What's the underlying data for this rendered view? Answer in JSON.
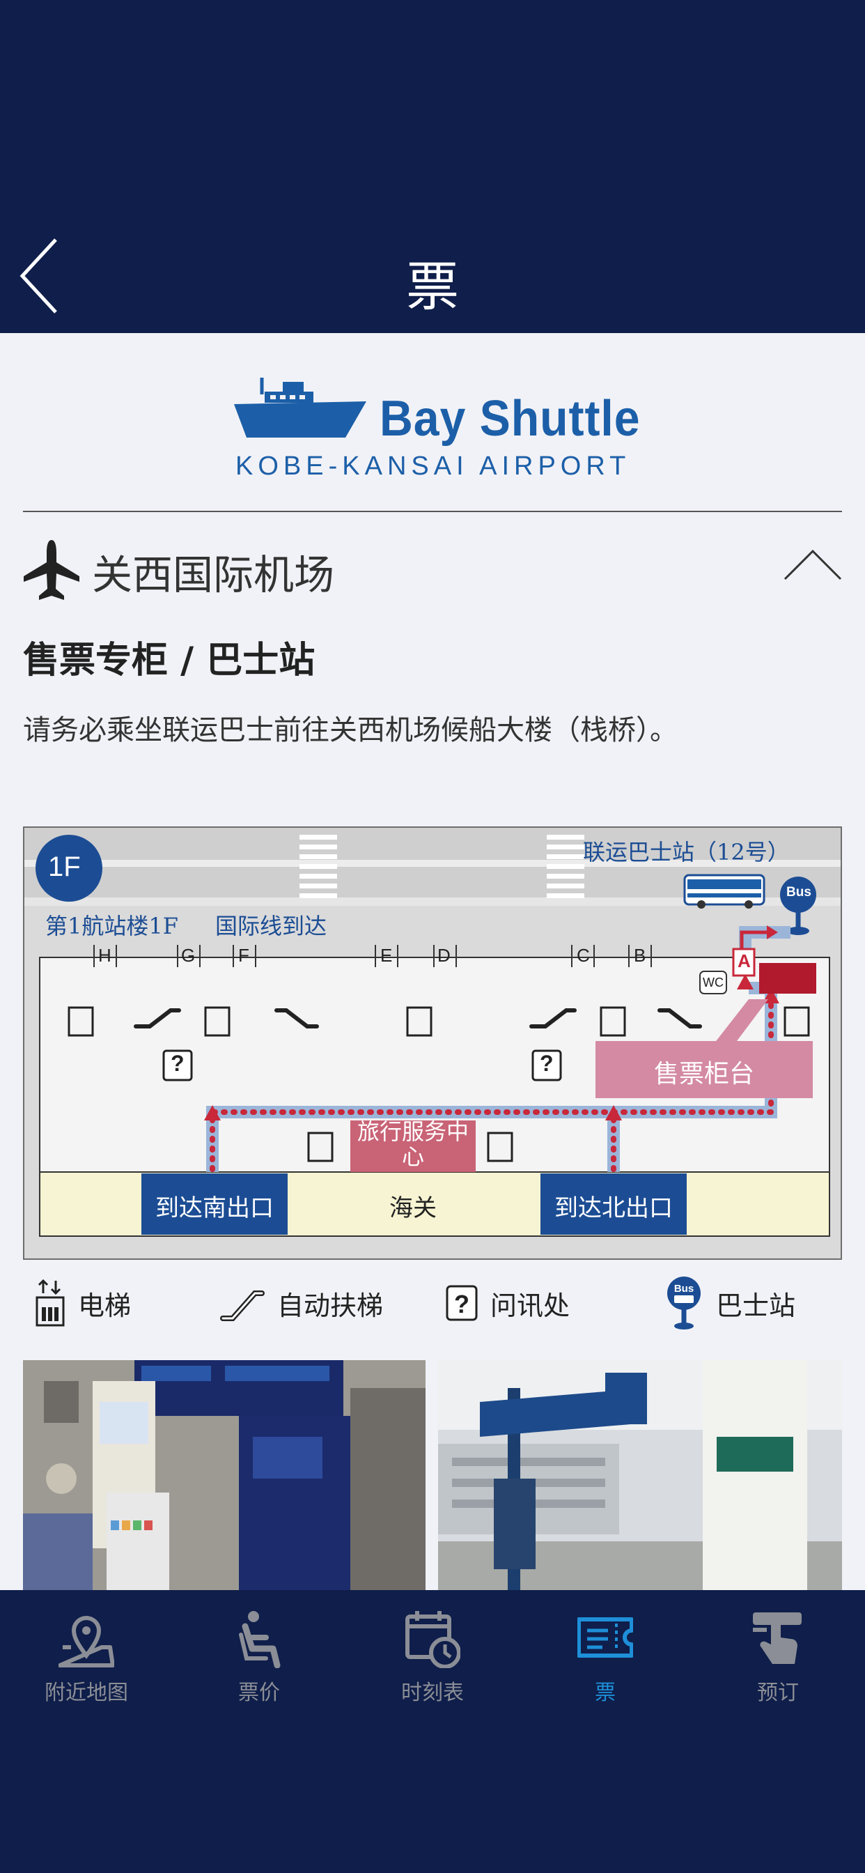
{
  "header": {
    "title": "票",
    "back_icon": "chevron-left-icon"
  },
  "brand": {
    "title": "Bay Shuttle",
    "subtitle": "KOBE-KANSAI AIRPORT",
    "color": "#1c5fa8"
  },
  "section": {
    "airport": "关西国际机场",
    "heading": "售票专柜 / 巴士站",
    "notice": "请务必乘坐联运巴士前往关西机场候船大楼（栈桥）。"
  },
  "map": {
    "floor": "1F",
    "terminal_label": "第1航站楼1F",
    "arrivals_label": "国际线到达",
    "bus_stop_label": "联运巴士站（12号）",
    "bus_badge": "Bus",
    "gates": [
      "H",
      "G",
      "F",
      "E",
      "D",
      "C",
      "B",
      "A"
    ],
    "wc": "WC",
    "info_mark": "?",
    "ticket_counter": "售票柜台",
    "travel_center": "旅行服务中心",
    "south_exit": "到达南出口",
    "customs": "海关",
    "north_exit": "到达北出口",
    "colors": {
      "route": "#c8283a",
      "path": "#9bb5d9",
      "counter": "#d48aa3",
      "exit": "#1c4d94"
    }
  },
  "legend": [
    {
      "icon": "elevator-icon",
      "label": "电梯"
    },
    {
      "icon": "escalator-icon",
      "label": "自动扶梯"
    },
    {
      "icon": "info-icon",
      "label": "问讯处"
    },
    {
      "icon": "bus-stop-icon",
      "label": "巴士站"
    }
  ],
  "tabs": [
    {
      "icon": "map-pin-icon",
      "label": "附近地图"
    },
    {
      "icon": "seat-icon",
      "label": "票价"
    },
    {
      "icon": "timetable-icon",
      "label": "时刻表"
    },
    {
      "icon": "ticket-icon",
      "label": "票",
      "active": true
    },
    {
      "icon": "tap-icon",
      "label": "预订"
    }
  ],
  "tab_colors": {
    "inactive": "#8b8e96",
    "active": "#1e8fd8"
  }
}
